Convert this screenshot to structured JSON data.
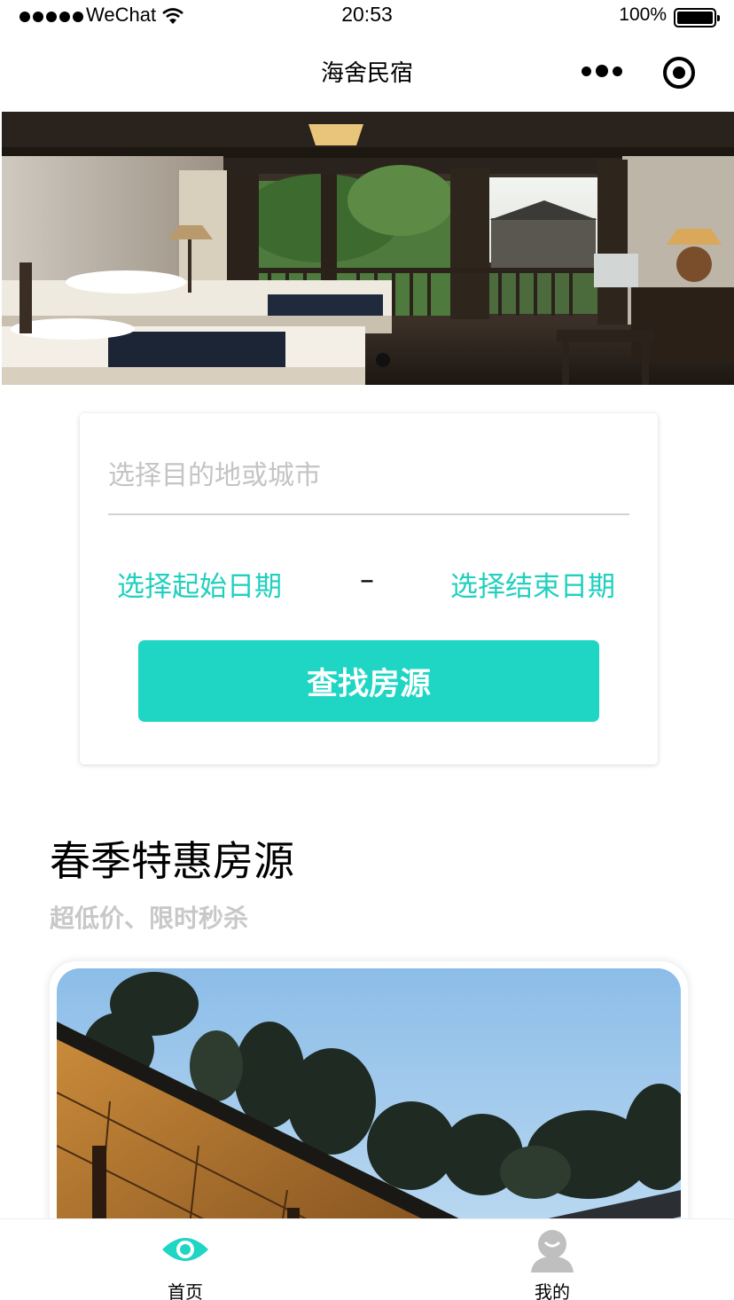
{
  "status_bar": {
    "carrier": "WeChat",
    "time": "20:53",
    "battery": "100%"
  },
  "nav": {
    "title": "海舍民宿",
    "more_icon": "more-dots-icon",
    "close_icon": "target-close-icon"
  },
  "banner": {
    "image": "hotel room with two beds and open wooden doors",
    "indicator_count": 1,
    "active_index": 0
  },
  "search": {
    "destination_placeholder": "选择目的地或城市",
    "start_date_label": "选择起始日期",
    "separator": "–",
    "end_date_label": "选择结束日期",
    "button_label": "查找房源"
  },
  "promo": {
    "title": "春季特惠房源",
    "subtitle": "超低价、限时秒杀",
    "card_image": "wooden lodge roof under blue evening sky with trees"
  },
  "tabbar": {
    "items": [
      {
        "label": "首页",
        "icon": "eye-icon",
        "active": true
      },
      {
        "label": "我的",
        "icon": "user-icon",
        "active": false
      }
    ]
  },
  "colors": {
    "accent": "#1fd5c4",
    "accent_text": "#1fd0bf",
    "placeholder": "#c4c4c4",
    "subtitle": "#c8c8c8"
  }
}
